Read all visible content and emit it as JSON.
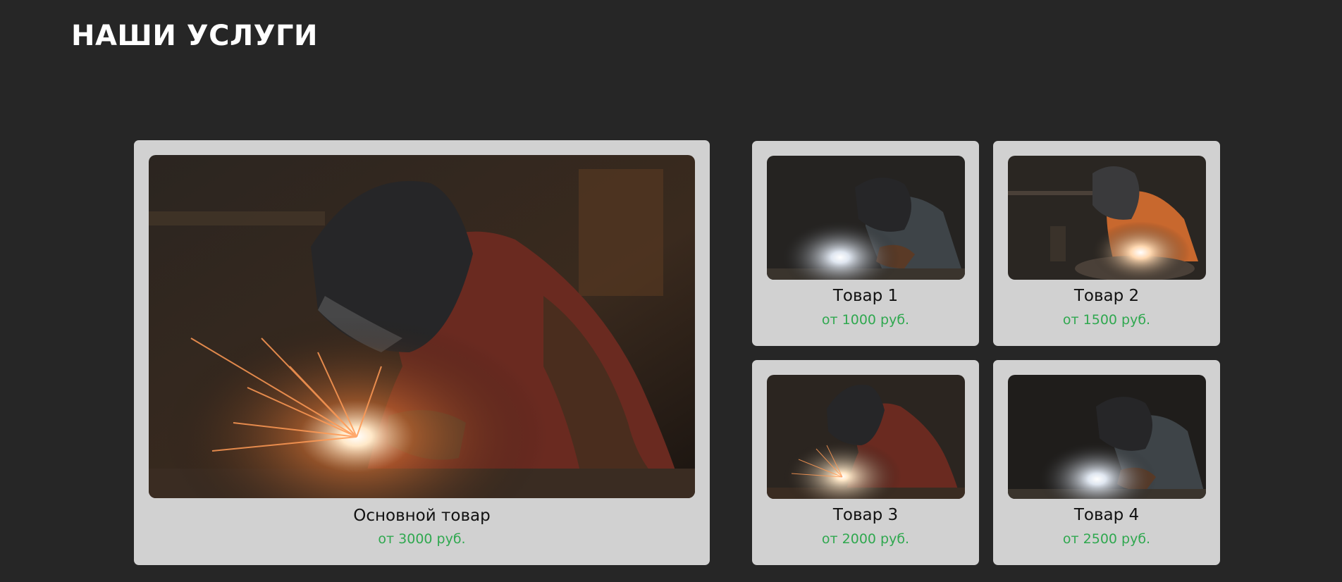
{
  "section": {
    "title": "НАШИ УСЛУГИ"
  },
  "colors": {
    "background": "#262626",
    "card": "#d1d1d1",
    "price": "#2fa84f"
  },
  "products": {
    "main": {
      "name": "Основной товар",
      "price": "от 3000 руб.",
      "image": "welder-sparks-photo"
    },
    "items": [
      {
        "name": "Товар 1",
        "price": "от 1000 руб.",
        "image": "welder-photo"
      },
      {
        "name": "Товар 2",
        "price": "от 1500 руб.",
        "image": "welder-orange-jacket-photo"
      },
      {
        "name": "Товар 3",
        "price": "от 2000 руб.",
        "image": "welder-sparks-photo"
      },
      {
        "name": "Товар 4",
        "price": "от 2500 руб.",
        "image": "welder-photo"
      }
    ]
  }
}
